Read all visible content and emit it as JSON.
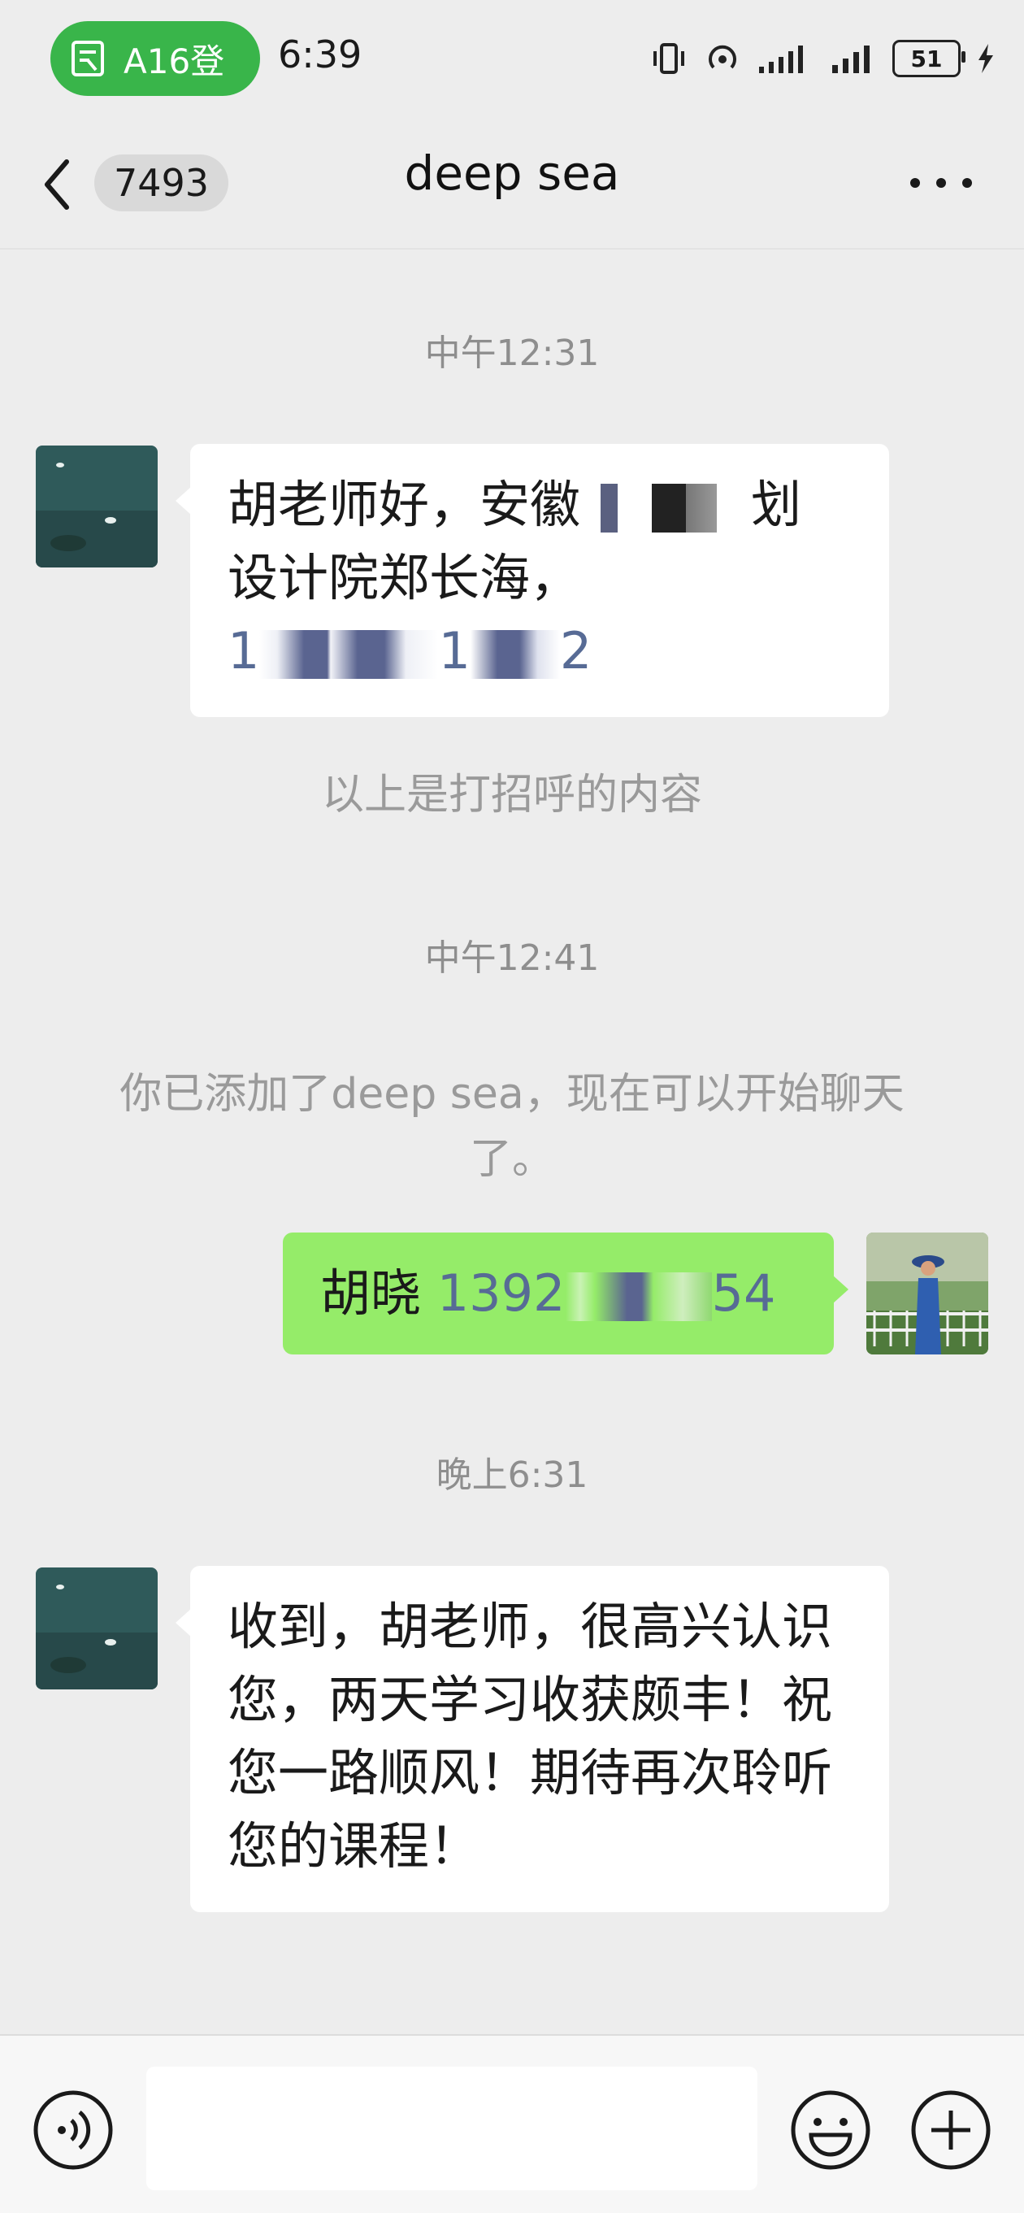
{
  "status_bar": {
    "notification_label": "A16登",
    "time": "6:39",
    "battery": "51"
  },
  "nav": {
    "unread_count": "7493",
    "title": "deep sea"
  },
  "chat": {
    "timestamp_1": "中午12:31",
    "msg1_line1": "胡老师好，安徽",
    "msg1_line1_tail": "划",
    "msg1_line2": "设计院郑长海，",
    "msg1_line3a": "1",
    "msg1_line3b": "1",
    "msg1_line3c": "2",
    "system_1": "以上是打招呼的内容",
    "timestamp_2": "中午12:41",
    "system_2": "你已添加了deep sea，现在可以开始聊天了。",
    "msg2_name": "胡晓 ",
    "msg2_num_a": "1392",
    "msg2_num_b": "54",
    "timestamp_3": "晚上6:31",
    "msg3": "收到，胡老师，很高兴认识您，两天学习收获颇丰！祝您一路顺风！期待再次聆听您的课程！"
  },
  "colors": {
    "bg": "#ededed",
    "bubble_sent": "#95ec69",
    "bubble_received": "#ffffff",
    "pill": "#39b54a",
    "link": "#576b95"
  },
  "icons": [
    "notification-icon",
    "vibrate-icon",
    "hotspot-icon",
    "signal-icon",
    "battery-icon",
    "charging-icon",
    "back-arrow-icon",
    "more-icon",
    "voice-icon",
    "emoji-icon",
    "plus-icon"
  ]
}
